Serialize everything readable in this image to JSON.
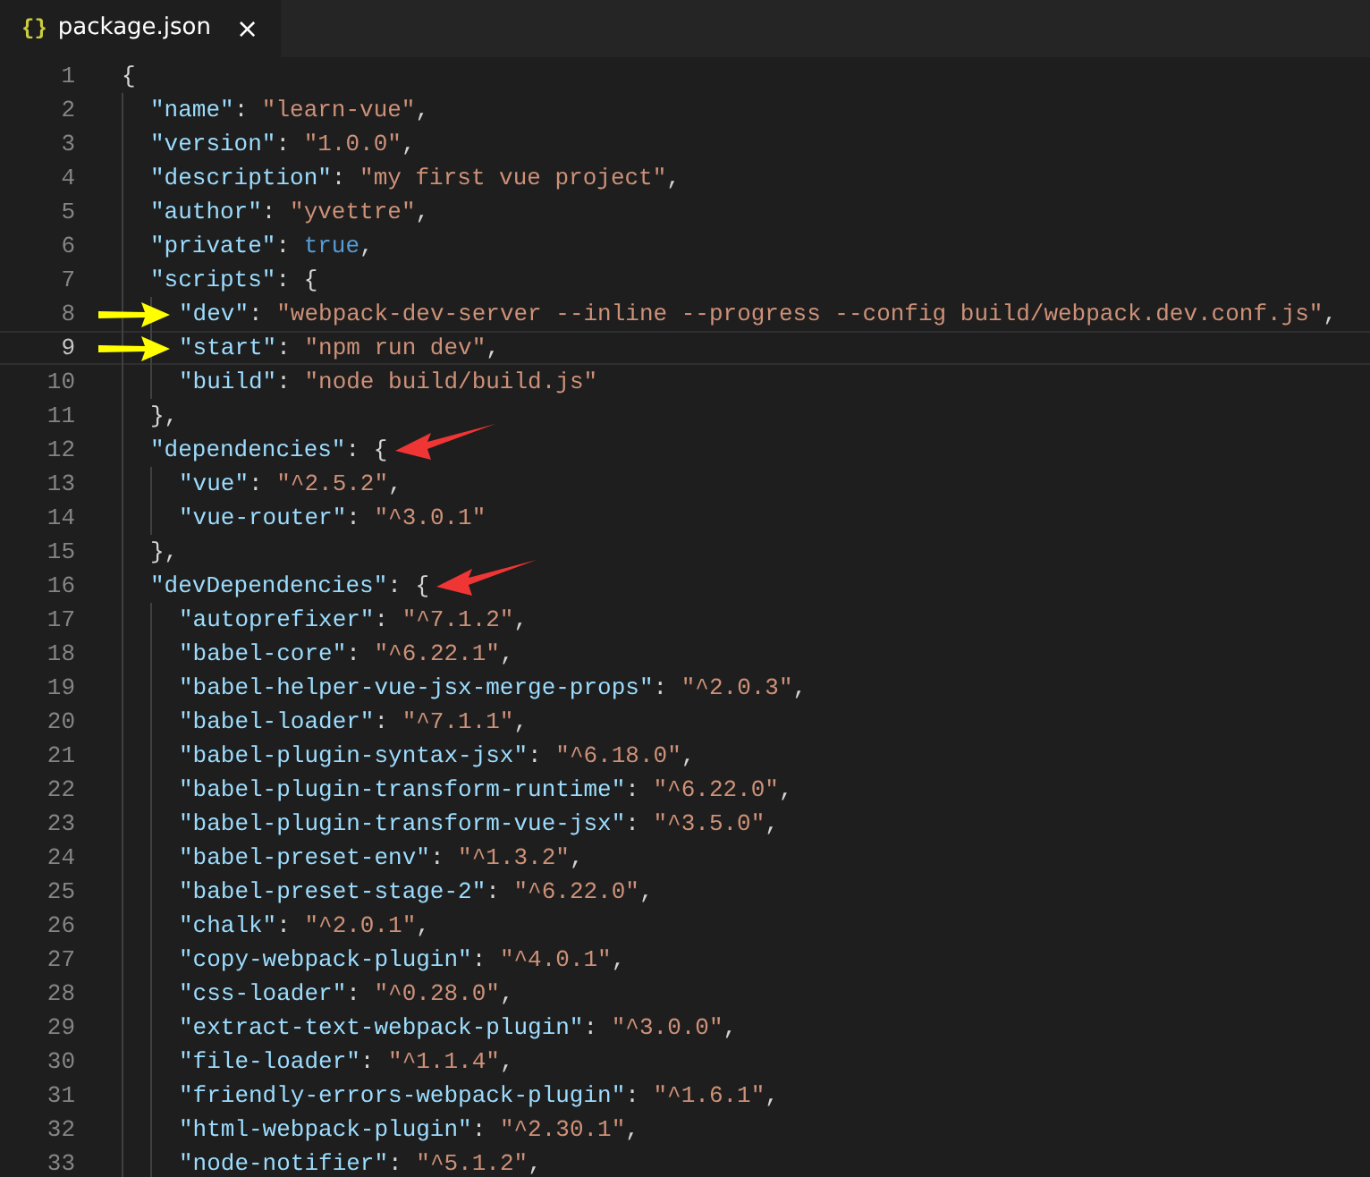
{
  "tab": {
    "icon": "{}",
    "title": "package.json",
    "close": "×",
    "selected": true
  },
  "lines": [
    {
      "number": "1",
      "current": false,
      "tokens": [
        {
          "kind": "punct",
          "text": "{"
        }
      ],
      "children": [
        {
          "number": "2",
          "current": false,
          "tokens": [
            {
              "kind": "key",
              "text": "\"name\""
            },
            {
              "kind": "punct",
              "text": ": "
            },
            {
              "kind": "string",
              "text": "\"learn-vue\""
            },
            {
              "kind": "punct",
              "text": ","
            }
          ]
        },
        {
          "number": "3",
          "current": false,
          "tokens": [
            {
              "kind": "key",
              "text": "\"version\""
            },
            {
              "kind": "punct",
              "text": ": "
            },
            {
              "kind": "string",
              "text": "\"1.0.0\""
            },
            {
              "kind": "punct",
              "text": ","
            }
          ]
        },
        {
          "number": "4",
          "current": false,
          "tokens": [
            {
              "kind": "key",
              "text": "\"description\""
            },
            {
              "kind": "punct",
              "text": ": "
            },
            {
              "kind": "string",
              "text": "\"my first vue project\""
            },
            {
              "kind": "punct",
              "text": ","
            }
          ]
        },
        {
          "number": "5",
          "current": false,
          "tokens": [
            {
              "kind": "key",
              "text": "\"author\""
            },
            {
              "kind": "punct",
              "text": ": "
            },
            {
              "kind": "string",
              "text": "\"yvettre\""
            },
            {
              "kind": "punct",
              "text": ","
            }
          ]
        },
        {
          "number": "6",
          "current": false,
          "tokens": [
            {
              "kind": "key",
              "text": "\"private\""
            },
            {
              "kind": "punct",
              "text": ": "
            },
            {
              "kind": "keyword",
              "text": "true"
            },
            {
              "kind": "punct",
              "text": ","
            }
          ]
        },
        {
          "number": "7",
          "current": false,
          "tokens": [
            {
              "kind": "key",
              "text": "\"scripts\""
            },
            {
              "kind": "punct",
              "text": ": {"
            }
          ],
          "children": [
            {
              "number": "8",
              "current": false,
              "arrow": {
                "kind": "margin",
                "color": "#ffff00"
              },
              "tokens": [
                {
                  "kind": "key",
                  "text": "\"dev\""
                },
                {
                  "kind": "punct",
                  "text": ": "
                },
                {
                  "kind": "string",
                  "text": "\"webpack-dev-server --inline --progress --config build/webpack.dev.conf.js\""
                },
                {
                  "kind": "punct",
                  "text": ","
                }
              ]
            },
            {
              "number": "9",
              "current": true,
              "arrow": {
                "kind": "margin",
                "color": "#ffff00"
              },
              "tokens": [
                {
                  "kind": "key",
                  "text": "\"start\""
                },
                {
                  "kind": "punct",
                  "text": ": "
                },
                {
                  "kind": "string",
                  "text": "\"npm run dev\""
                },
                {
                  "kind": "punct",
                  "text": ","
                }
              ]
            },
            {
              "number": "10",
              "current": false,
              "tokens": [
                {
                  "kind": "key",
                  "text": "\"build\""
                },
                {
                  "kind": "punct",
                  "text": ": "
                },
                {
                  "kind": "string",
                  "text": "\"node build/build.js\""
                }
              ]
            }
          ]
        },
        {
          "number": "11",
          "current": false,
          "tokens": [
            {
              "kind": "punct",
              "text": "},"
            }
          ]
        },
        {
          "number": "12",
          "current": false,
          "arrow": {
            "kind": "trailing",
            "color": "#f03535"
          },
          "tokens": [
            {
              "kind": "key",
              "text": "\"dependencies\""
            },
            {
              "kind": "punct",
              "text": ": {"
            }
          ],
          "children": [
            {
              "number": "13",
              "current": false,
              "tokens": [
                {
                  "kind": "key",
                  "text": "\"vue\""
                },
                {
                  "kind": "punct",
                  "text": ": "
                },
                {
                  "kind": "string",
                  "text": "\"^2.5.2\""
                },
                {
                  "kind": "punct",
                  "text": ","
                }
              ]
            },
            {
              "number": "14",
              "current": false,
              "tokens": [
                {
                  "kind": "key",
                  "text": "\"vue-router\""
                },
                {
                  "kind": "punct",
                  "text": ": "
                },
                {
                  "kind": "string",
                  "text": "\"^3.0.1\""
                }
              ]
            }
          ]
        },
        {
          "number": "15",
          "current": false,
          "tokens": [
            {
              "kind": "punct",
              "text": "},"
            }
          ]
        },
        {
          "number": "16",
          "current": false,
          "arrow": {
            "kind": "trailing",
            "color": "#f03535"
          },
          "tokens": [
            {
              "kind": "key",
              "text": "\"devDependencies\""
            },
            {
              "kind": "punct",
              "text": ": {"
            }
          ],
          "children": [
            {
              "number": "17",
              "current": false,
              "tokens": [
                {
                  "kind": "key",
                  "text": "\"autoprefixer\""
                },
                {
                  "kind": "punct",
                  "text": ": "
                },
                {
                  "kind": "string",
                  "text": "\"^7.1.2\""
                },
                {
                  "kind": "punct",
                  "text": ","
                }
              ]
            },
            {
              "number": "18",
              "current": false,
              "tokens": [
                {
                  "kind": "key",
                  "text": "\"babel-core\""
                },
                {
                  "kind": "punct",
                  "text": ": "
                },
                {
                  "kind": "string",
                  "text": "\"^6.22.1\""
                },
                {
                  "kind": "punct",
                  "text": ","
                }
              ]
            },
            {
              "number": "19",
              "current": false,
              "tokens": [
                {
                  "kind": "key",
                  "text": "\"babel-helper-vue-jsx-merge-props\""
                },
                {
                  "kind": "punct",
                  "text": ": "
                },
                {
                  "kind": "string",
                  "text": "\"^2.0.3\""
                },
                {
                  "kind": "punct",
                  "text": ","
                }
              ]
            },
            {
              "number": "20",
              "current": false,
              "tokens": [
                {
                  "kind": "key",
                  "text": "\"babel-loader\""
                },
                {
                  "kind": "punct",
                  "text": ": "
                },
                {
                  "kind": "string",
                  "text": "\"^7.1.1\""
                },
                {
                  "kind": "punct",
                  "text": ","
                }
              ]
            },
            {
              "number": "21",
              "current": false,
              "tokens": [
                {
                  "kind": "key",
                  "text": "\"babel-plugin-syntax-jsx\""
                },
                {
                  "kind": "punct",
                  "text": ": "
                },
                {
                  "kind": "string",
                  "text": "\"^6.18.0\""
                },
                {
                  "kind": "punct",
                  "text": ","
                }
              ]
            },
            {
              "number": "22",
              "current": false,
              "tokens": [
                {
                  "kind": "key",
                  "text": "\"babel-plugin-transform-runtime\""
                },
                {
                  "kind": "punct",
                  "text": ": "
                },
                {
                  "kind": "string",
                  "text": "\"^6.22.0\""
                },
                {
                  "kind": "punct",
                  "text": ","
                }
              ]
            },
            {
              "number": "23",
              "current": false,
              "tokens": [
                {
                  "kind": "key",
                  "text": "\"babel-plugin-transform-vue-jsx\""
                },
                {
                  "kind": "punct",
                  "text": ": "
                },
                {
                  "kind": "string",
                  "text": "\"^3.5.0\""
                },
                {
                  "kind": "punct",
                  "text": ","
                }
              ]
            },
            {
              "number": "24",
              "current": false,
              "tokens": [
                {
                  "kind": "key",
                  "text": "\"babel-preset-env\""
                },
                {
                  "kind": "punct",
                  "text": ": "
                },
                {
                  "kind": "string",
                  "text": "\"^1.3.2\""
                },
                {
                  "kind": "punct",
                  "text": ","
                }
              ]
            },
            {
              "number": "25",
              "current": false,
              "tokens": [
                {
                  "kind": "key",
                  "text": "\"babel-preset-stage-2\""
                },
                {
                  "kind": "punct",
                  "text": ": "
                },
                {
                  "kind": "string",
                  "text": "\"^6.22.0\""
                },
                {
                  "kind": "punct",
                  "text": ","
                }
              ]
            },
            {
              "number": "26",
              "current": false,
              "tokens": [
                {
                  "kind": "key",
                  "text": "\"chalk\""
                },
                {
                  "kind": "punct",
                  "text": ": "
                },
                {
                  "kind": "string",
                  "text": "\"^2.0.1\""
                },
                {
                  "kind": "punct",
                  "text": ","
                }
              ]
            },
            {
              "number": "27",
              "current": false,
              "tokens": [
                {
                  "kind": "key",
                  "text": "\"copy-webpack-plugin\""
                },
                {
                  "kind": "punct",
                  "text": ": "
                },
                {
                  "kind": "string",
                  "text": "\"^4.0.1\""
                },
                {
                  "kind": "punct",
                  "text": ","
                }
              ]
            },
            {
              "number": "28",
              "current": false,
              "tokens": [
                {
                  "kind": "key",
                  "text": "\"css-loader\""
                },
                {
                  "kind": "punct",
                  "text": ": "
                },
                {
                  "kind": "string",
                  "text": "\"^0.28.0\""
                },
                {
                  "kind": "punct",
                  "text": ","
                }
              ]
            },
            {
              "number": "29",
              "current": false,
              "tokens": [
                {
                  "kind": "key",
                  "text": "\"extract-text-webpack-plugin\""
                },
                {
                  "kind": "punct",
                  "text": ": "
                },
                {
                  "kind": "string",
                  "text": "\"^3.0.0\""
                },
                {
                  "kind": "punct",
                  "text": ","
                }
              ]
            },
            {
              "number": "30",
              "current": false,
              "tokens": [
                {
                  "kind": "key",
                  "text": "\"file-loader\""
                },
                {
                  "kind": "punct",
                  "text": ": "
                },
                {
                  "kind": "string",
                  "text": "\"^1.1.4\""
                },
                {
                  "kind": "punct",
                  "text": ","
                }
              ]
            },
            {
              "number": "31",
              "current": false,
              "tokens": [
                {
                  "kind": "key",
                  "text": "\"friendly-errors-webpack-plugin\""
                },
                {
                  "kind": "punct",
                  "text": ": "
                },
                {
                  "kind": "string",
                  "text": "\"^1.6.1\""
                },
                {
                  "kind": "punct",
                  "text": ","
                }
              ]
            },
            {
              "number": "32",
              "current": false,
              "tokens": [
                {
                  "kind": "key",
                  "text": "\"html-webpack-plugin\""
                },
                {
                  "kind": "punct",
                  "text": ": "
                },
                {
                  "kind": "string",
                  "text": "\"^2.30.1\""
                },
                {
                  "kind": "punct",
                  "text": ","
                }
              ]
            },
            {
              "number": "33",
              "current": false,
              "tokens": [
                {
                  "kind": "key",
                  "text": "\"node-notifier\""
                },
                {
                  "kind": "punct",
                  "text": ": "
                },
                {
                  "kind": "string",
                  "text": "\"^5.1.2\""
                },
                {
                  "kind": "punct",
                  "text": ","
                }
              ]
            }
          ]
        }
      ]
    }
  ]
}
